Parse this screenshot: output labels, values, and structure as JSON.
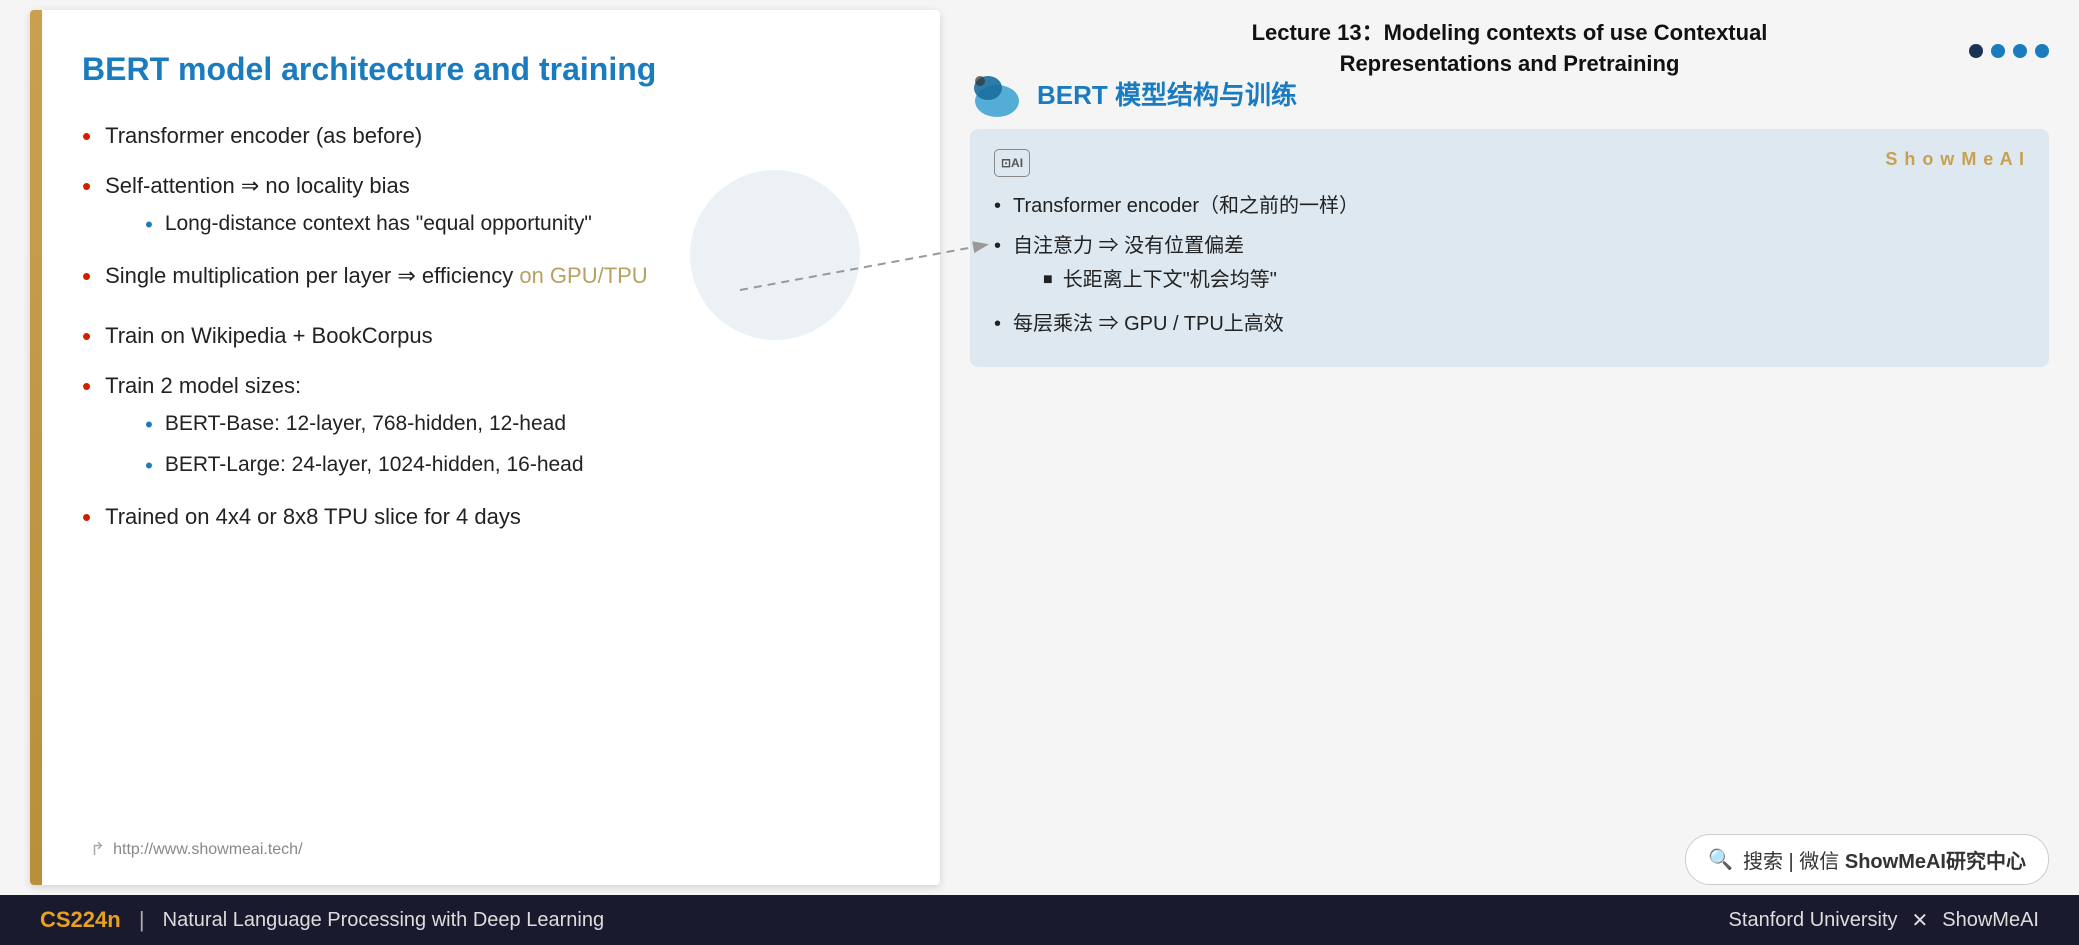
{
  "slide": {
    "title": "BERT model architecture and training",
    "bullets": [
      {
        "text": "Transformer encoder (as before)",
        "sub": []
      },
      {
        "text": "Self-attention ⇒ no locality bias",
        "sub": [
          {
            "text": "Long-distance context has “equal opportunity”"
          }
        ]
      },
      {
        "text": "Single multiplication per layer ⇒ efficiency on GPU/TPU",
        "gpu_highlight": true,
        "sub": []
      },
      {
        "text": "Train on Wikipedia + BookCorpus",
        "sub": []
      },
      {
        "text": "Train 2 model sizes:",
        "sub": [
          {
            "text": "BERT-Base: 12-layer, 768-hidden, 12-head"
          },
          {
            "text": "BERT-Large: 24-layer, 1024-hidden, 16-head"
          }
        ]
      },
      {
        "text": "Trained on 4x4 or 8x8 TPU slice for 4 days",
        "sub": []
      }
    ],
    "url": "http://www.showmeai.tech/"
  },
  "lecture": {
    "header_line1": "Lecture 13：Modeling contexts of use Contextual",
    "header_line2": "Representations and Pretraining"
  },
  "bert_section": {
    "title": "BERT 模型结构与训练"
  },
  "translation_box": {
    "ai_badge": "⊡",
    "showmeai_label": "S h o w M e A I",
    "bullets": [
      {
        "text": "Transformer encoder（和之前的一样）",
        "sub": []
      },
      {
        "text": "自注意力 ⇒ 没有位置偏差",
        "sub": [
          {
            "text": "长距离上下文“机会均等”"
          }
        ]
      },
      {
        "text": "每层乘法 ⇒ GPU / TPU上高效",
        "sub": []
      }
    ]
  },
  "search_box": {
    "placeholder": "🔍 搜索 | 微信 ShowMeAI研究中心"
  },
  "bottom_bar": {
    "cs224n": "CS224n",
    "divider": "|",
    "subtitle": "Natural Language Processing with Deep Learning",
    "right": "Stanford University  ✕  ShowMeAI"
  },
  "dots": [
    "dark",
    "blue",
    "blue",
    "blue"
  ],
  "colors": {
    "title_blue": "#1a7bbf",
    "accent_gold": "#c8a050",
    "bullet_red": "#cc2200",
    "bottom_bg": "#1a1a2e",
    "bottom_gold": "#e8a020"
  }
}
